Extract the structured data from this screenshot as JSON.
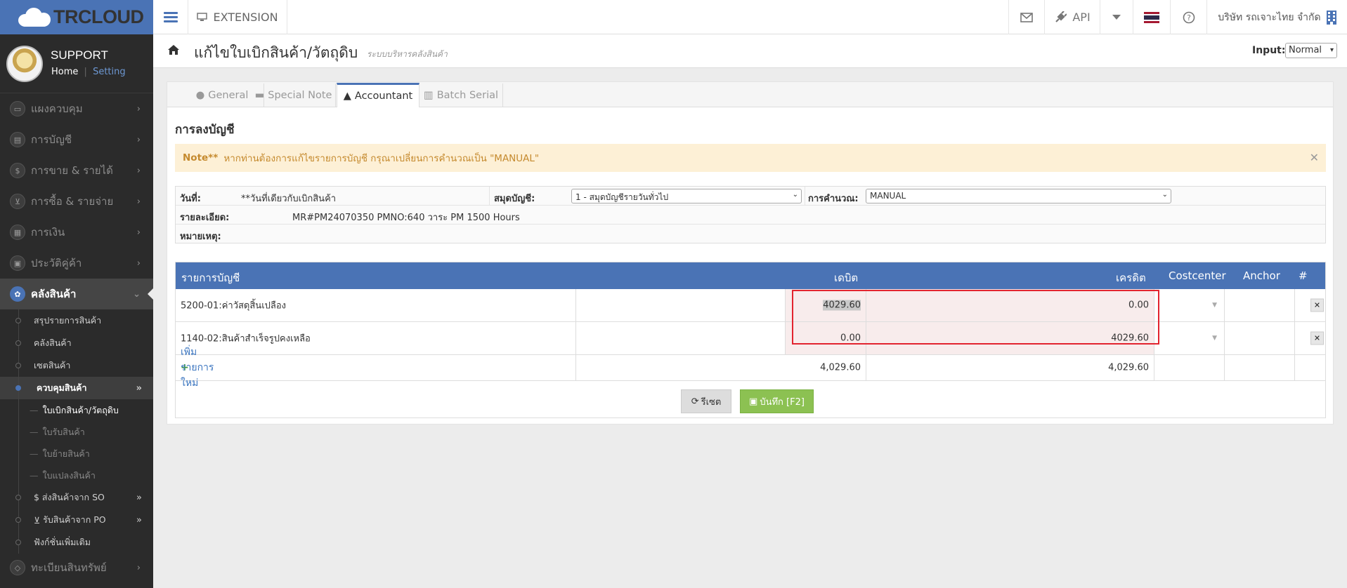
{
  "app": {
    "logo": "TRCLOUD",
    "extension_label": "EXTENSION",
    "api_label": "API",
    "company": "บริษัท รถเจาะไทย จำกัด"
  },
  "profile": {
    "name": "SUPPORT",
    "home": "Home",
    "sep": "|",
    "setting": "Setting"
  },
  "nav": {
    "items": [
      {
        "label": "แผงควบคุม",
        "icon": "monitor-icon"
      },
      {
        "label": "การบัญชี",
        "icon": "book-icon"
      },
      {
        "label": "การขาย & รายได้",
        "icon": "dollar-icon"
      },
      {
        "label": "การซื้อ & รายจ่าย",
        "icon": "cart-icon"
      },
      {
        "label": "การเงิน",
        "icon": "calendar-icon"
      },
      {
        "label": "ประวัติคู่ค้า",
        "icon": "contact-icon"
      },
      {
        "label": "คลังสินค้า",
        "icon": "warehouse-icon"
      }
    ],
    "inventory_sub": [
      "สรุปรายการสินค้า",
      "คลังสินค้า",
      "เซตสินค้า"
    ],
    "control_label": "ควบคุมสินค้า",
    "control_sub": [
      "ใบเบิกสินค้า/วัตถุดิบ",
      "ใบรับสินค้า",
      "ใบย้ายสินค้า",
      "ใบแปลงสินค้า"
    ],
    "after_sub": [
      "$ ส่งสินค้าจาก SO",
      "รับสินค้าจาก PO",
      "ฟังก์ชั่นเพิ่มเติม"
    ],
    "last_item": "ทะเบียนสินทรัพย์"
  },
  "page": {
    "title": "แก้ไขใบเบิกสินค้า/วัตถุดิบ",
    "subtitle": "ระบบบริหารคลังสินค้า",
    "input_label": "Input:",
    "input_value": "Normal"
  },
  "tabs": {
    "general": "General",
    "special": "Special Note",
    "acc": "Accountant",
    "batch": "Batch Serial"
  },
  "section_title": "การลงบัญชี",
  "note": {
    "prefix": "Note**",
    "text": "หากท่านต้องการแก้ไขรายการบัญชี กรุณาเปลี่ยนการคำนวณเป็น \"MANUAL\""
  },
  "form": {
    "date_label": "วันที่:",
    "date_value": "**วันที่เดียวกับเบิกสินค้า",
    "journal_label": "สมุดบัญชี:",
    "journal_value": "1 - สมุดบัญชีรายวันทั่วไป",
    "calc_label": "การคำนวณ:",
    "calc_value": "MANUAL",
    "detail_label": "รายละเอียด:",
    "detail_value": "MR#PM24070350 PMNO:640  วาระ PM 1500 Hours",
    "remark_label": "หมายเหตุ:"
  },
  "table": {
    "headers": {
      "account": "รายการบัญชี",
      "debit": "เดบิต",
      "credit": "เครดิต",
      "costcenter": "Costcenter",
      "anchor": "Anchor",
      "hash": "#"
    },
    "rows": [
      {
        "account": "5200-01:ค่าวัสดุสิ้นเปลือง",
        "debit": "4029.60",
        "credit": "0.00"
      },
      {
        "account": "1140-02:สินค้าสำเร็จรูปคงเหลือ",
        "debit": "0.00",
        "credit": "4029.60"
      }
    ],
    "add_row": "เพิ่มรายการใหม่",
    "total_debit": "4,029.60",
    "total_credit": "4,029.60"
  },
  "buttons": {
    "reset": "รีเซต",
    "save": "บันทึก [F2]"
  },
  "colors": {
    "brand": "#4a73b5",
    "save": "#8cc152",
    "highlight": "#e2242f",
    "note_bg": "#fdf0d6"
  }
}
